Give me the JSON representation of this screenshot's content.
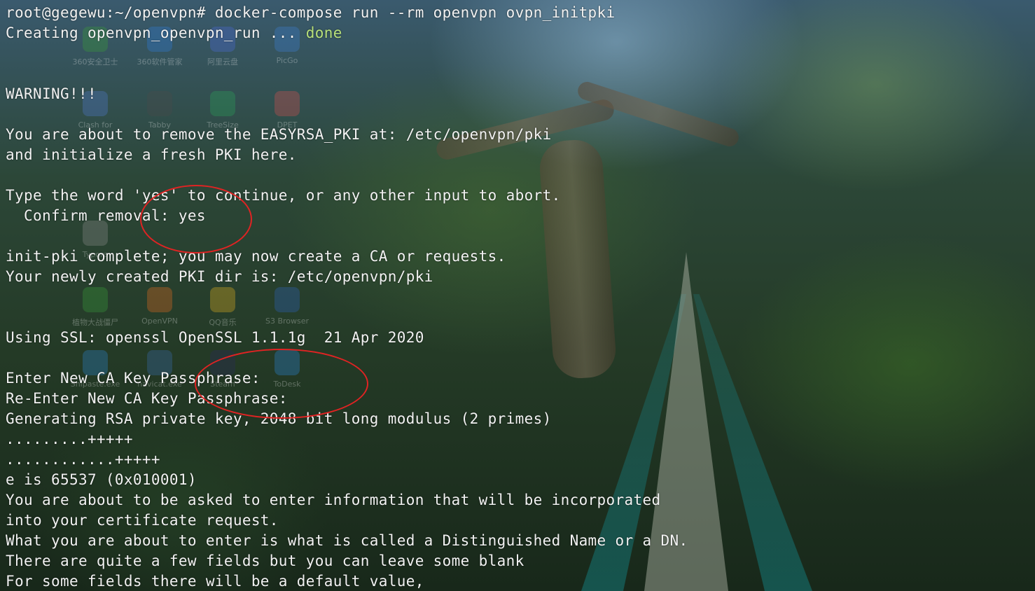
{
  "window": {
    "accent_annotation_color": "#e02323",
    "text_color": "#f2f2f2",
    "success_color": "#b8e07a"
  },
  "desktop_icons": [
    {
      "label": "360安全卫士",
      "icon": "shield-icon"
    },
    {
      "label": "360软件管家",
      "icon": "package-icon"
    },
    {
      "label": "阿里云盘",
      "icon": "cloud-icon"
    },
    {
      "label": "PicGo",
      "icon": "image-icon"
    },
    {
      "label": "Clash for",
      "icon": "cat-icon"
    },
    {
      "label": "Tabby",
      "icon": "terminal-icon"
    },
    {
      "label": "TreeSize",
      "icon": "pie-icon"
    },
    {
      "label": "DPET",
      "icon": "disk-icon"
    },
    {
      "label": "Typora",
      "icon": "typora-icon"
    },
    {
      "label": "植物大战僵尸",
      "icon": "game-icon"
    },
    {
      "label": "OpenVPN",
      "icon": "openvpn-icon"
    },
    {
      "label": "QQ音乐",
      "icon": "music-icon"
    },
    {
      "label": "S3 Browser",
      "icon": "s3-icon"
    },
    {
      "label": "Snipaste.exe",
      "icon": "snip-icon"
    },
    {
      "label": "navicat.exe",
      "icon": "db-icon"
    },
    {
      "label": "Steam",
      "icon": "steam-icon"
    },
    {
      "label": "ToDesk",
      "icon": "todesk-icon"
    }
  ],
  "terminal": {
    "lines": [
      {
        "text": "root@gegewu:~/openvpn# docker-compose run --rm openvpn ovpn_initpki"
      },
      {
        "text": "Creating openvpn_openvpn_run ... ",
        "status": "done"
      },
      {
        "text": ""
      },
      {
        "text": ""
      },
      {
        "text": "WARNING!!!"
      },
      {
        "text": ""
      },
      {
        "text": "You are about to remove the EASYRSA_PKI at: /etc/openvpn/pki"
      },
      {
        "text": "and initialize a fresh PKI here."
      },
      {
        "text": ""
      },
      {
        "text": "Type the word 'yes' to continue, or any other input to abort."
      },
      {
        "text": "  Confirm removal: yes"
      },
      {
        "text": ""
      },
      {
        "text": "init-pki complete; you may now create a CA or requests."
      },
      {
        "text": "Your newly created PKI dir is: /etc/openvpn/pki"
      },
      {
        "text": ""
      },
      {
        "text": ""
      },
      {
        "text": "Using SSL: openssl OpenSSL 1.1.1g  21 Apr 2020"
      },
      {
        "text": ""
      },
      {
        "text": "Enter New CA Key Passphrase:"
      },
      {
        "text": "Re-Enter New CA Key Passphrase:"
      },
      {
        "text": "Generating RSA private key, 2048 bit long modulus (2 primes)"
      },
      {
        "text": ".........+++++"
      },
      {
        "text": "............+++++"
      },
      {
        "text": "e is 65537 (0x010001)"
      },
      {
        "text": "You are about to be asked to enter information that will be incorporated"
      },
      {
        "text": "into your certificate request."
      },
      {
        "text": "What you are about to enter is what is called a Distinguished Name or a DN."
      },
      {
        "text": "There are quite a few fields but you can leave some blank"
      },
      {
        "text": "For some fields there will be a default value,"
      }
    ]
  }
}
